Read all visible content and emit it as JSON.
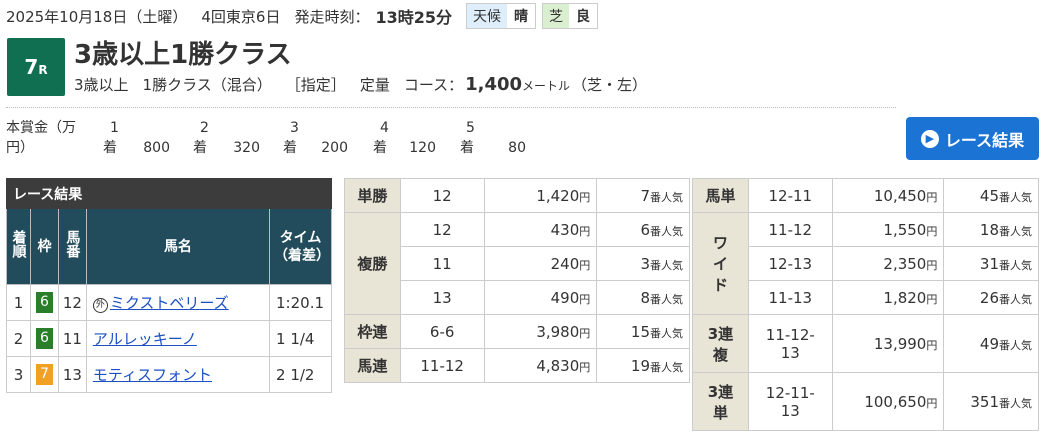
{
  "header": {
    "date": "2025年10月18日（土曜）",
    "kaisai": "4回東京6日",
    "start_label": "発走時刻：",
    "start_time": "13時25分",
    "weather_label": "天候",
    "weather_value": "晴",
    "track_label": "芝",
    "track_value": "良"
  },
  "race": {
    "number": "7",
    "r": "R",
    "name": "3歳以上1勝クラス",
    "age": "3歳以上",
    "class": "1勝クラス（混合）",
    "cond": "［指定］",
    "weight": "定量",
    "course_label": "コース：",
    "distance": "1,400",
    "unit": "メートル",
    "course_type": "（芝・左）"
  },
  "prize": {
    "label": "本賞金（万円）",
    "places": [
      {
        "rank": "1",
        "chaku": "着",
        "value": "800"
      },
      {
        "rank": "2",
        "chaku": "着",
        "value": "320"
      },
      {
        "rank": "3",
        "chaku": "着",
        "value": "200"
      },
      {
        "rank": "4",
        "chaku": "着",
        "value": "120"
      },
      {
        "rank": "5",
        "chaku": "着",
        "value": "80"
      }
    ]
  },
  "result_button": "レース結果",
  "results": {
    "caption": "レース結果",
    "headers": {
      "rank": "着順",
      "waku": "枠",
      "umaban": "馬番",
      "name": "馬名",
      "time": "タイム（着差）"
    },
    "rows": [
      {
        "rank": "1",
        "waku": "6",
        "waku_color": "#2a7d2a",
        "umaban": "12",
        "mark": "外",
        "name": "ミクストベリーズ",
        "time": "1:20.1"
      },
      {
        "rank": "2",
        "waku": "6",
        "waku_color": "#2a7d2a",
        "umaban": "11",
        "mark": "",
        "name": "アルレッキーノ",
        "time": "1 1/4"
      },
      {
        "rank": "3",
        "waku": "7",
        "waku_color": "#f0a023",
        "umaban": "13",
        "mark": "",
        "name": "モティスフォント",
        "time": "2 1/2"
      }
    ]
  },
  "payouts": {
    "yen": "円",
    "pop": "番人気",
    "left": [
      {
        "type": "単勝",
        "rows": [
          {
            "num": "12",
            "amount": "1,420",
            "rank": "7"
          }
        ]
      },
      {
        "type": "複勝",
        "rows": [
          {
            "num": "12",
            "amount": "430",
            "rank": "6"
          },
          {
            "num": "11",
            "amount": "240",
            "rank": "3"
          },
          {
            "num": "13",
            "amount": "490",
            "rank": "8"
          }
        ]
      },
      {
        "type": "枠連",
        "rows": [
          {
            "num": "6-6",
            "amount": "3,980",
            "rank": "15"
          }
        ]
      },
      {
        "type": "馬連",
        "rows": [
          {
            "num": "11-12",
            "amount": "4,830",
            "rank": "19"
          }
        ]
      }
    ],
    "right": [
      {
        "type": "馬単",
        "rows": [
          {
            "num": "12-11",
            "amount": "10,450",
            "rank": "45"
          }
        ]
      },
      {
        "type": "ワイド",
        "rows": [
          {
            "num": "11-12",
            "amount": "1,550",
            "rank": "18"
          },
          {
            "num": "12-13",
            "amount": "2,350",
            "rank": "31"
          },
          {
            "num": "11-13",
            "amount": "1,820",
            "rank": "26"
          }
        ]
      },
      {
        "type": "3連複",
        "rows": [
          {
            "num": "11-12-13",
            "amount": "13,990",
            "rank": "49"
          }
        ]
      },
      {
        "type": "3連単",
        "rows": [
          {
            "num": "12-11-13",
            "amount": "100,650",
            "rank": "351"
          }
        ]
      }
    ]
  }
}
